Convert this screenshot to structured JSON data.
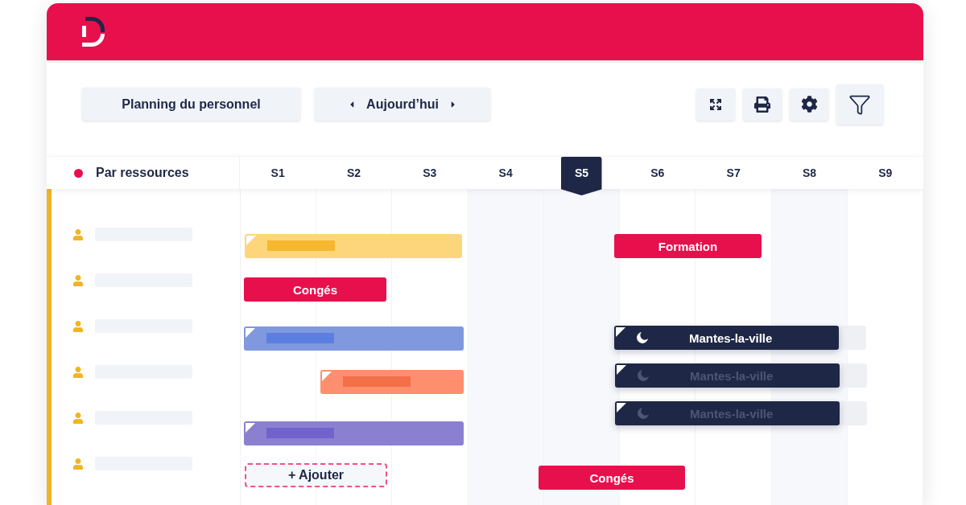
{
  "toolbar": {
    "view_button": "Planning du personnel",
    "today_button": "Aujourd’hui"
  },
  "grid_header": {
    "title": "Par ressources"
  },
  "weeks": [
    {
      "label": "S1",
      "selected": false,
      "shaded": false
    },
    {
      "label": "S2",
      "selected": false,
      "shaded": false
    },
    {
      "label": "S3",
      "selected": false,
      "shaded": false
    },
    {
      "label": "S4",
      "selected": false,
      "shaded": true
    },
    {
      "label": "S5",
      "selected": true,
      "shaded": true
    },
    {
      "label": "S6",
      "selected": false,
      "shaded": false
    },
    {
      "label": "S7",
      "selected": false,
      "shaded": false
    },
    {
      "label": "S8",
      "selected": false,
      "shaded": true
    },
    {
      "label": "S9",
      "selected": false,
      "shaded": false
    }
  ],
  "resources": [
    {
      "kind": "placeholder"
    },
    {
      "kind": "placeholder"
    },
    {
      "kind": "placeholder"
    },
    {
      "kind": "placeholder"
    },
    {
      "kind": "placeholder"
    },
    {
      "kind": "placeholder"
    }
  ],
  "events": [
    {
      "kind": "blank",
      "color": "#fdd67c"
    },
    {
      "kind": "label",
      "label": "Formation",
      "color": "#e8104c"
    },
    {
      "kind": "label",
      "label": "Congés",
      "color": "#e8104c"
    },
    {
      "kind": "blank",
      "color": "#7f98de"
    },
    {
      "kind": "shift",
      "label": "Mantes-la-ville",
      "active": true
    },
    {
      "kind": "blank",
      "color": "#fd8f6e"
    },
    {
      "kind": "shift",
      "label": "Mantes-la-ville",
      "active": false
    },
    {
      "kind": "shift",
      "label": "Mantes-la-ville",
      "active": false
    },
    {
      "kind": "blank",
      "color": "#8b80cf"
    },
    {
      "kind": "add",
      "label": "+ Ajouter"
    },
    {
      "kind": "label",
      "label": "Congés",
      "color": "#e8104c"
    }
  ]
}
